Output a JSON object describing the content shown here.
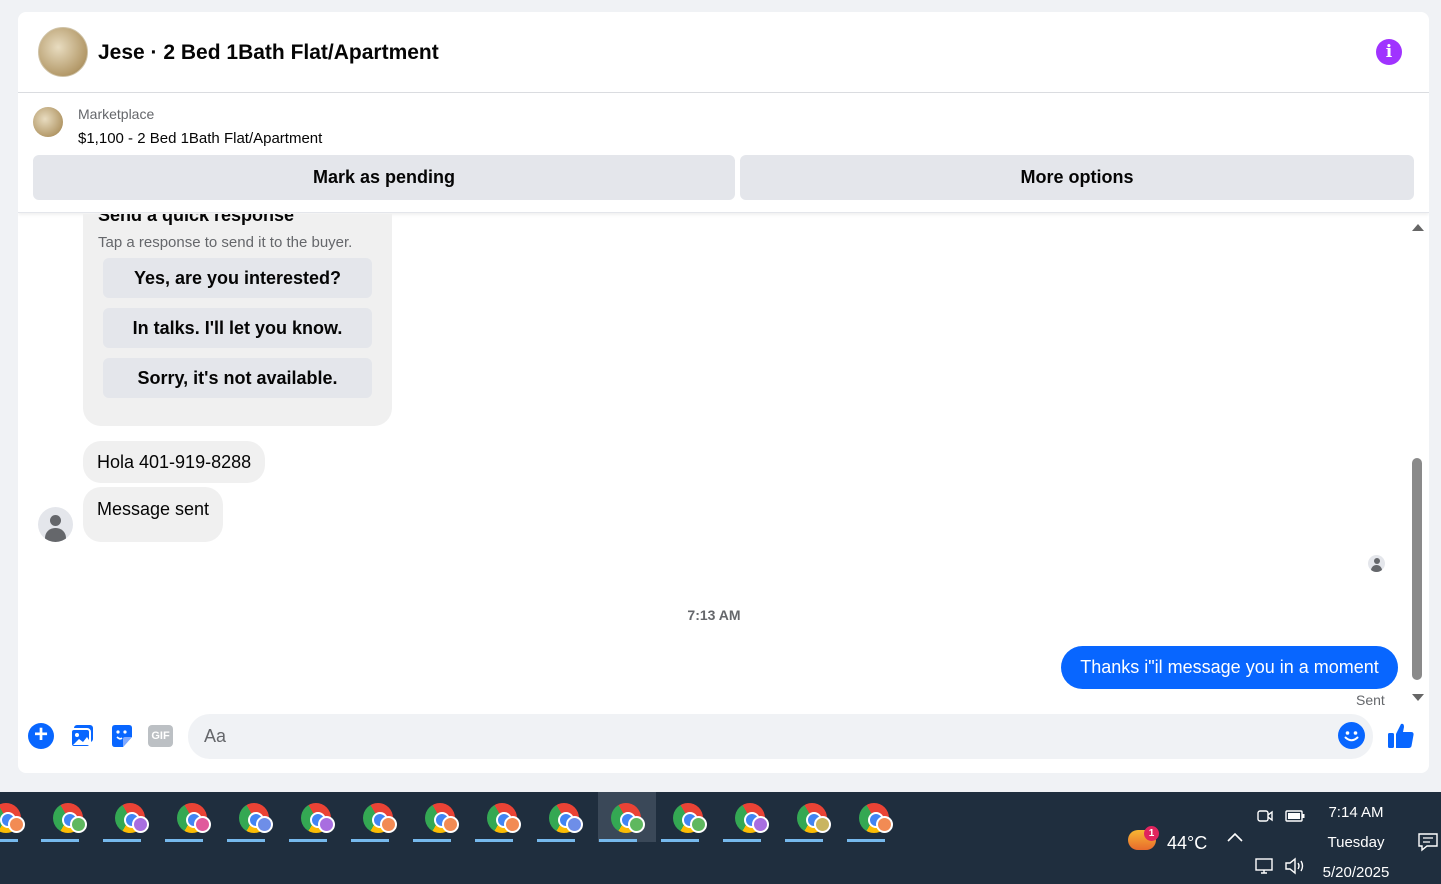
{
  "header": {
    "title": "Jese · 2 Bed 1Bath Flat/Apartment",
    "info_icon": "i"
  },
  "listing": {
    "source": "Marketplace",
    "title": "$1,100 - 2 Bed 1Bath Flat/Apartment",
    "mark_pending_label": "Mark as pending",
    "more_options_label": "More options"
  },
  "quick_response": {
    "title": "Send a quick response",
    "subtitle": "Tap a response to send it to the buyer.",
    "options": [
      "Yes, are you interested?",
      "In talks. I'll let you know.",
      "Sorry, it's not available."
    ]
  },
  "messages": {
    "incoming": [
      "Hola 401-919-8288",
      "Message sent"
    ],
    "timestamp": "7:13 AM",
    "outgoing": "Thanks i\"il message you in a moment",
    "status": "Sent"
  },
  "composer": {
    "placeholder": "Aa",
    "gif_label": "GIF",
    "plus_label": "+"
  },
  "taskbar": {
    "app_badge_colors": [
      "#f28b54",
      "#5fb85f",
      "#a86ee0",
      "#e05a9c",
      "#6e8ee8",
      "#a86ee0",
      "#f28b54",
      "#f28b54",
      "#f28b54",
      "#6e8ee8",
      "#5fb85f",
      "#5fb85f",
      "#a86ee0",
      "#c9b560",
      "#f28b54"
    ],
    "active_index": 10,
    "weather_badge": "1",
    "temperature": "44°C",
    "time": "7:14 AM",
    "day": "Tuesday",
    "date": "5/20/2025"
  },
  "colors": {
    "accent": "#0866ff",
    "info": "#a033ff"
  }
}
